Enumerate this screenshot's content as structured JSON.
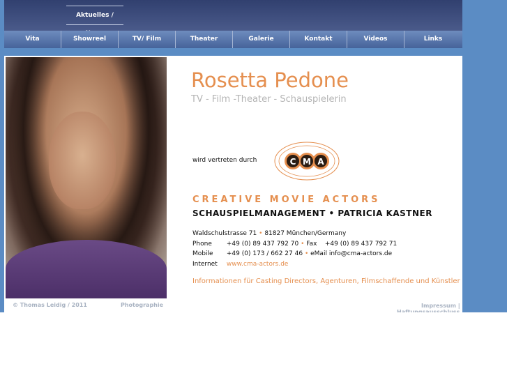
{
  "header": {
    "news_link": "Aktuelles / News"
  },
  "nav": {
    "items": [
      {
        "label": "Vita"
      },
      {
        "label": "Showreel"
      },
      {
        "label": "TV/ Film"
      },
      {
        "label": "Theater"
      },
      {
        "label": "Galerie"
      },
      {
        "label": "Kontakt"
      },
      {
        "label": "Videos"
      },
      {
        "label": "Links"
      }
    ]
  },
  "profile": {
    "name": "Rosetta Pedone",
    "subtitle": "TV - Film -Theater - Schauspielerin",
    "represented_by": "wird vertreten durch"
  },
  "agency": {
    "logo_text": "CMA",
    "title": "CREATIVE MOVIE ACTORS",
    "subtitle": "SCHAUSPIELMANAGEMENT • PATRICIA KASTNER",
    "street": "Waldschulstrasse 71",
    "city": "81827 München/Germany",
    "phone_label": "Phone",
    "phone": "+49 (0) 89 437 792 70",
    "fax_label": "Fax",
    "fax": "+49 (0) 89 437 792 71",
    "mobile_label": "Mobile",
    "mobile": "+49 (0) 173 / 662 27 46",
    "email_label": "eMail",
    "email": "info@cma-actors.de",
    "internet_label": "Internet",
    "website": "www.cma-actors.de",
    "casting_info": "Informationen für Casting Directors, Agenturen, Filmschaffende und Künstler"
  },
  "footer": {
    "copyright": "© Thomas Leidig / 2011",
    "photographie": "Photographie",
    "impressum": "Impressum  |",
    "haftung": "Haftungsausschluss"
  },
  "colors": {
    "accent_orange": "#e58f4f",
    "header_navy": "#31406f",
    "page_blue": "#5b8cc4"
  }
}
